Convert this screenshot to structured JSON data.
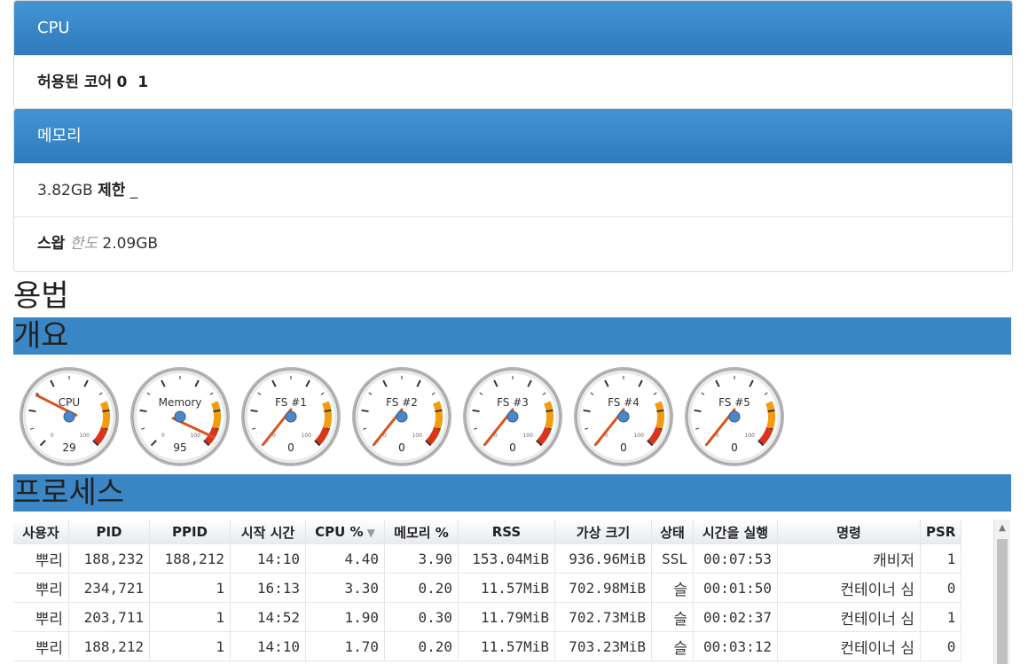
{
  "cpu_panel": {
    "title": "CPU",
    "cores_label": "허용된 코어",
    "cores_value": "0  1"
  },
  "memory_panel": {
    "title": "메모리",
    "memory_value": "3.82GB",
    "memory_label": "제한",
    "memory_suffix": "_",
    "swap_label": "스왑",
    "swap_sublabel": "한도",
    "swap_value": "2.09GB"
  },
  "usage_title": "용법",
  "overview_title": "개요",
  "gauges": [
    {
      "label": "CPU",
      "value": 29
    },
    {
      "label": "Memory",
      "value": 95
    },
    {
      "label": "FS #1",
      "value": 0
    },
    {
      "label": "FS #2",
      "value": 0
    },
    {
      "label": "FS #3",
      "value": 0
    },
    {
      "label": "FS #4",
      "value": 0
    },
    {
      "label": "FS #5",
      "value": 0
    }
  ],
  "gauge_scale": {
    "min": "0",
    "max": "100"
  },
  "process_title": "프로세스",
  "process_table": {
    "headers": [
      "사용자",
      "PID",
      "PPID",
      "시작 시간",
      "CPU %",
      "메모리 %",
      "RSS",
      "가상 크기",
      "상태",
      "시간을 실행",
      "명령",
      "PSR"
    ],
    "rows": [
      [
        "뿌리",
        "188,232",
        "188,212",
        "14:10",
        "4.40",
        "3.90",
        "153.04MiB",
        "936.96MiB",
        "SSL",
        "00:07:53",
        "캐비저",
        "1"
      ],
      [
        "뿌리",
        "234,721",
        "1",
        "16:13",
        "3.30",
        "0.20",
        "11.57MiB",
        "702.98MiB",
        "슬",
        "00:01:50",
        "컨테이너 심",
        "0"
      ],
      [
        "뿌리",
        "203,711",
        "1",
        "14:52",
        "1.90",
        "0.30",
        "11.79MiB",
        "702.73MiB",
        "슬",
        "00:02:37",
        "컨테이너 심",
        "1"
      ],
      [
        "뿌리",
        "188,212",
        "1",
        "14:10",
        "1.70",
        "0.20",
        "11.57MiB",
        "703.23MiB",
        "슬",
        "00:03:12",
        "컨테이너 심",
        "0"
      ]
    ]
  },
  "colors": {
    "panel_header": "#3b87c6",
    "gauge_needle": "#d9541e",
    "gauge_hub": "#4a86c8",
    "gauge_warn": "#f39c12",
    "gauge_danger": "#d9341c"
  }
}
